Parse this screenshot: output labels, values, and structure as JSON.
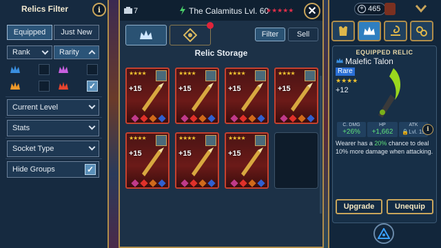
{
  "filter": {
    "title": "Relics Filter",
    "tabs": [
      "Equipped",
      "Just New"
    ],
    "rank_label": "Rank",
    "rarity_label": "Rarity",
    "rarity_checked": [
      false,
      false,
      false,
      true
    ],
    "dropdowns": [
      "Current Level",
      "Stats",
      "Socket Type"
    ],
    "hide_groups_label": "Hide Groups",
    "hide_groups_checked": true
  },
  "storage": {
    "count": "7",
    "champion_name": "The Calamitus Lvl. 60",
    "title": "Relic Storage",
    "filter_label": "Filter",
    "sell_label": "Sell",
    "relics": [
      {
        "level": "+15",
        "stars": "★★★★"
      },
      {
        "level": "+15",
        "stars": "★★★★"
      },
      {
        "level": "+15",
        "stars": "★★★★"
      },
      {
        "level": "+15",
        "stars": "★★★★"
      },
      {
        "level": "+15",
        "stars": "★★★★"
      },
      {
        "level": "+15",
        "stars": "★★★★"
      },
      {
        "level": "+15",
        "stars": "★★★★"
      }
    ]
  },
  "top": {
    "currency": "465"
  },
  "equipped": {
    "header": "EQUIPPED RELIC",
    "name": "Malefic Talon",
    "rarity": "Rare",
    "stars": "★★★★",
    "level": "+12",
    "stats": [
      {
        "label": "C. DMG",
        "value": "+26%"
      },
      {
        "label": "HP",
        "value": "+1,662"
      },
      {
        "label": "ATK",
        "value": "Lvl. 15"
      }
    ],
    "description_pre": "Wearer has a ",
    "description_highlight": "20%",
    "description_post": " chance to deal 10% more damage when attacking.",
    "upgrade_label": "Upgrade",
    "unequip_label": "Unequip"
  },
  "colors": {
    "accent_gold": "#b08d4a",
    "rarity_blue": "#2a6fd6",
    "stat_green": "#5fe07a"
  }
}
